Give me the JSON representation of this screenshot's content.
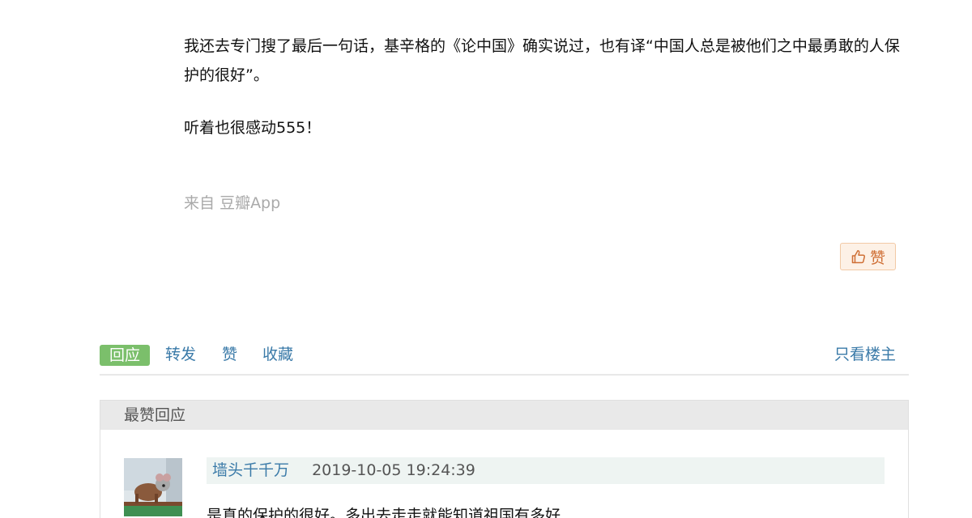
{
  "post": {
    "paragraph_1": "我还去专门搜了最后一句话，基辛格的《论中国》确实说过，也有译“中国人总是被他们之中最勇敢的人保护的很好”。",
    "paragraph_2": "听着也很感动555！",
    "source_prefix": "来自",
    "source_app": "豆瓣App",
    "like_label": "赞"
  },
  "actions": {
    "reply": "回应",
    "forward": "转发",
    "like": "赞",
    "collect": "收藏",
    "only_op": "只看楼主"
  },
  "best_replies": {
    "header": "最赞回应",
    "items": [
      {
        "author": "墙头千千万",
        "time": "2019-10-05 19:24:39",
        "text": "是真的保护的很好。多出去走走就能知道祖国有多好"
      }
    ]
  },
  "colors": {
    "link": "#3a7aa8",
    "reply_button": "#7bbf6b",
    "like_button_bg": "#fdf1e6",
    "like_button_text": "#cf6f35"
  },
  "icons": {
    "like": "thumbs-up-icon"
  }
}
